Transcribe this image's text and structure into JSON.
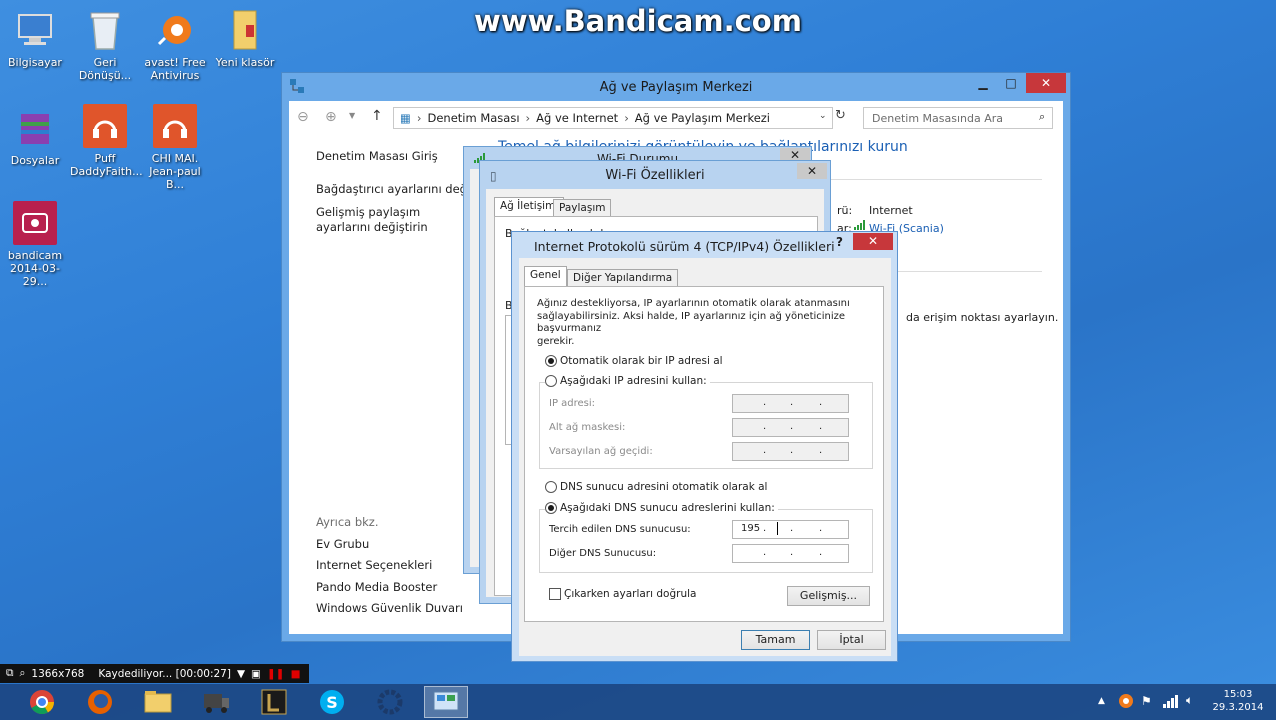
{
  "watermark": "www.Bandicam.com",
  "desktop": {
    "icons": [
      {
        "label1": "Bilgisayar",
        "label2": ""
      },
      {
        "label1": "Geri",
        "label2": "Dönüşü..."
      },
      {
        "label1": "avast! Free",
        "label2": "Antivirus"
      },
      {
        "label1": "Yeni klasör",
        "label2": ""
      },
      {
        "label1": "Dosyalar",
        "label2": ""
      },
      {
        "label1": "Puff",
        "label2": "DaddyFaith..."
      },
      {
        "label1": "CHI MAI.",
        "label2": "Jean-paul B..."
      },
      {
        "label1": "bandicam",
        "label2": "2014-03-29..."
      }
    ]
  },
  "explorer": {
    "title": "Ağ ve Paylaşım Merkezi",
    "breadcrumb": [
      "Denetim Masası",
      "Ağ ve Internet",
      "Ağ ve Paylaşım Merkezi"
    ],
    "search_placeholder": "Denetim Masasında Ara",
    "left_links": [
      "Denetim Masası Giriş",
      "Bağdaştırıcı ayarlarını değiştir",
      "Gelişmiş paylaşım ayarlarını değiştirin"
    ],
    "see_also_title": "Ayrıca bkz.",
    "see_also": [
      "Ev Grubu",
      "Internet Seçenekleri",
      "Pando Media Booster",
      "Windows Güvenlik Duvarı"
    ],
    "heading": "Temel ağ bilgilerinizi görüntüleyin ve bağlantılarınızı kurun",
    "access_label": "rü:",
    "access_value": "Internet",
    "conn_label": "ar:",
    "conn_value": "Wi-Fi (Scania)",
    "setup_text": "da erişim noktası ayarlayın."
  },
  "wifi_status": {
    "title": "Wi-Fi Durumu"
  },
  "wifi_props": {
    "title": "Wi-Fi Özellikleri",
    "tabs": [
      "Ağ İletişimi",
      "Paylaşım"
    ],
    "partial1": "Bağlantı kullanılırken:",
    "partial2": "B"
  },
  "ipv4": {
    "title": "Internet Protokolü sürüm 4 (TCP/IPv4) Özellikleri",
    "help": "?",
    "tabs": [
      "Genel",
      "Diğer Yapılandırma"
    ],
    "intro": [
      "Ağınız destekliyorsa, IP ayarlarının otomatik olarak atanmasını",
      "sağlayabilirsiniz. Aksi halde, IP ayarlarınız için ağ yöneticinize başvurmanız",
      "gerekir."
    ],
    "auto_ip": "Otomatik olarak bir IP adresi al",
    "manual_ip": "Aşağıdaki IP adresini kullan:",
    "ip_label": "IP adresi:",
    "mask_label": "Alt ağ maskesi:",
    "gateway_label": "Varsayılan ağ geçidi:",
    "auto_dns": "DNS sunucu adresini otomatik olarak al",
    "manual_dns": "Aşağıdaki DNS sunucu adreslerini kullan:",
    "pref_dns_label": "Tercih edilen DNS sunucusu:",
    "pref_dns_first": "195",
    "alt_dns_label": "Diğer DNS Sunucusu:",
    "validate_label": "Çıkarken ayarları doğrula",
    "advanced": "Gelişmiş...",
    "ok": "Tamam",
    "cancel": "İptal",
    "dot": "."
  },
  "recorder": {
    "resolution": "1366x768",
    "status": "Kaydediliyor... [00:00:27]"
  },
  "tray": {
    "time": "15:03",
    "date": "29.3.2014"
  },
  "colors": {
    "accent": "#1a5fb4",
    "close": "#c7373b",
    "recording": "#e00000"
  }
}
